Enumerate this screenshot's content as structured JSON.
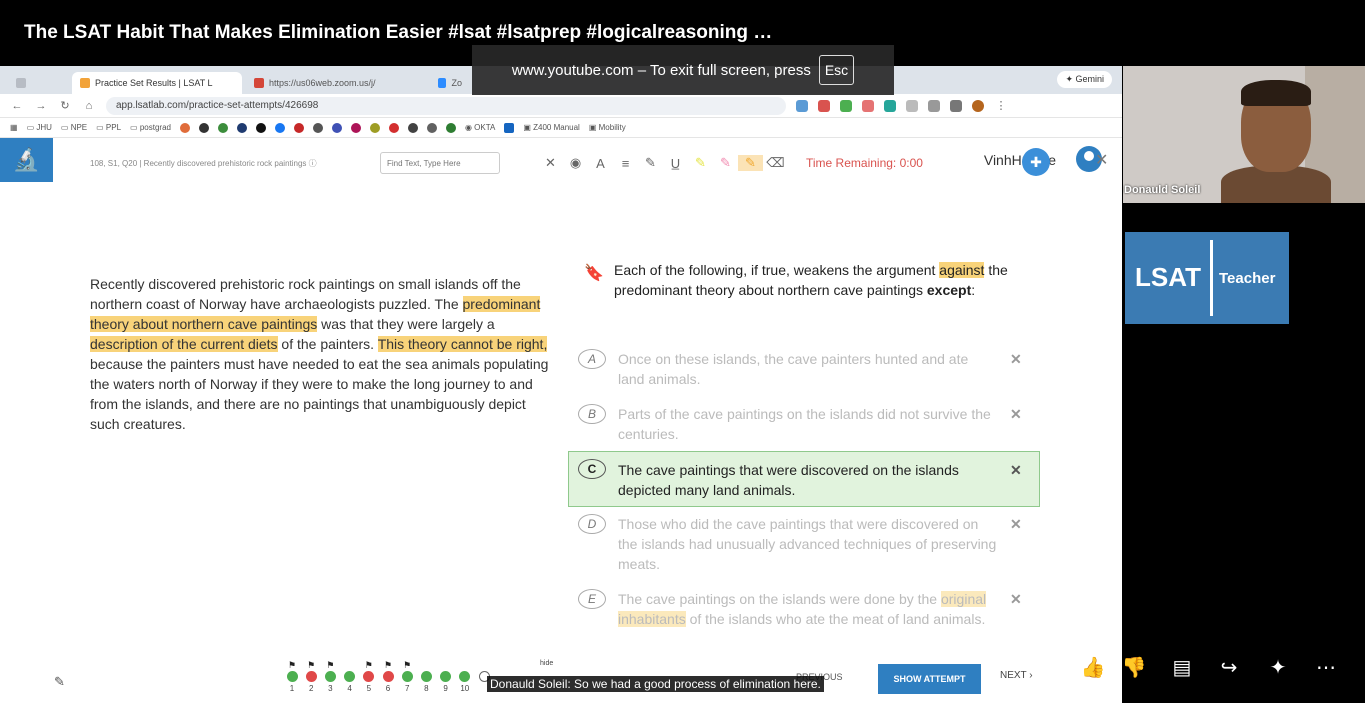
{
  "video": {
    "title": "The LSAT Habit That Makes Elimination Easier #lsat  #lsatprep  #logicalreasoning  …"
  },
  "fullscreen_notice": {
    "text": "www.youtube.com – To exit full screen, press",
    "key": "Esc"
  },
  "browser": {
    "tabs": [
      {
        "label": "Practice Set Results | LSAT L",
        "active": true
      },
      {
        "label": "https://us06web.zoom.us/j/",
        "active": false
      },
      {
        "label": "Zo",
        "active": false
      }
    ],
    "gemini_label": "Gemini",
    "url": "app.lsatlab.com/practice-set-attempts/426698",
    "bookmarks": [
      "JHU",
      "NPE",
      "PPL",
      "postgrad",
      "OKTA",
      "Z400 Manual",
      "Mobility"
    ]
  },
  "app": {
    "user_name": "VinhHuy Le",
    "question_meta": "108, S1, Q20 | Recently discovered prehistoric rock paintings",
    "find_placeholder": "Find Text, Type Here",
    "timer": "Time Remaining: 0:00",
    "passage": {
      "p1": "Recently discovered prehistoric rock paintings on small islands off the northern coast of Norway have archaeologists puzzled. The ",
      "h1": "predominant theory about northern cave paintings",
      "p2": " was that they were largely a ",
      "h2": "description of the current diets",
      "p3": " of the painters. ",
      "h3": "This theory cannot be right,",
      "p4": " because the painters must have needed to eat the sea animals populating the waters north of Norway if they were to make the long journey to and from the islands, and there are no paintings that unambiguously depict such creatures."
    },
    "stem": {
      "a": "Each of the following, if true, weakens the argument ",
      "h": "against",
      "b": " the predominant theory about northern cave paintings ",
      "except": "except",
      "colon": ":"
    },
    "choices": [
      {
        "letter": "A",
        "text": "Once on these islands, the cave painters hunted and ate land animals.",
        "state": "eliminated"
      },
      {
        "letter": "B",
        "text": "Parts of the cave paintings on the islands did not survive the centuries.",
        "state": "eliminated"
      },
      {
        "letter": "C",
        "text": "The cave paintings that were discovered on the islands depicted many land animals.",
        "state": "selected"
      },
      {
        "letter": "D",
        "text": "Those who did the cave paintings that were discovered on the islands had unusually advanced techniques of preserving meats.",
        "state": "eliminated"
      },
      {
        "letter": "E",
        "text_a": "The cave paintings on the islands were done by the ",
        "text_h": "original inhabitants",
        "text_b": " of the islands who ate the meat of land animals.",
        "state": "eliminated"
      }
    ],
    "progress": [
      {
        "n": "1",
        "status": "correct",
        "flag": true
      },
      {
        "n": "2",
        "status": "incorrect",
        "flag": true
      },
      {
        "n": "3",
        "status": "correct",
        "flag": true
      },
      {
        "n": "4",
        "status": "correct",
        "flag": false
      },
      {
        "n": "5",
        "status": "incorrect",
        "flag": true
      },
      {
        "n": "6",
        "status": "incorrect",
        "flag": true
      },
      {
        "n": "7",
        "status": "correct",
        "flag": true
      },
      {
        "n": "8",
        "status": "correct",
        "flag": false
      },
      {
        "n": "9",
        "status": "correct",
        "flag": false
      },
      {
        "n": "10",
        "status": "correct",
        "flag": false
      },
      {
        "n": "",
        "status": "unanswered",
        "flag": false
      }
    ],
    "hide_label": "hide",
    "previous_label": "PREVIOUS",
    "show_attempt_label": "SHOW ATTEMPT",
    "next_label": "NEXT",
    "colors": {
      "brand": "#2f7fc1",
      "correct": "#4caf50",
      "incorrect": "#e04848",
      "highlight": "#f8d37a",
      "timer": "#d9534f"
    }
  },
  "caption": "Donauld Soleil: So we had a good process of elimination here.",
  "webcam": {
    "name": "Donauld Soleil"
  },
  "brand_logo": {
    "word1": "LSAT",
    "word2": "Teacher"
  },
  "yt_actions": [
    {
      "name": "like-icon",
      "glyph": "👍"
    },
    {
      "name": "dislike-icon",
      "glyph": "👎"
    },
    {
      "name": "comments-icon",
      "glyph": "💬"
    },
    {
      "name": "share-icon",
      "glyph": "↪"
    },
    {
      "name": "ask-ai-icon",
      "glyph": "✦"
    },
    {
      "name": "more-icon",
      "glyph": "⋯"
    }
  ]
}
